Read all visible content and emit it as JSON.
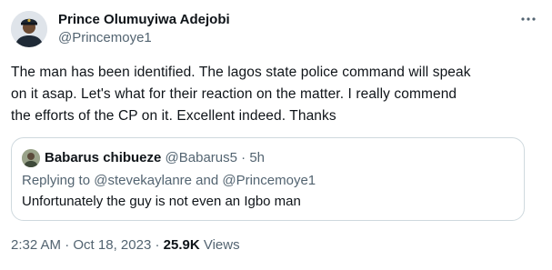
{
  "author": {
    "name": "Prince Olumuyiwa Adejobi",
    "handle": "@Princemoye1"
  },
  "tweet": {
    "text": "The man has been identified. The lagos state police command will speak\non it asap. Let's what for their reaction on the matter. I really commend\nthe efforts of the CP on it. Excellent indeed. Thanks"
  },
  "quote": {
    "name": "Babarus chibueze",
    "handle": "@Babarus5",
    "separator": "·",
    "time": "5h",
    "replying_prefix": "Replying to ",
    "replying_to_1": "@stevekaylanre",
    "replying_and": " and ",
    "replying_to_2": "@Princemoye1",
    "text": "Unfortunately the guy is not even an Igbo man"
  },
  "meta": {
    "time": "2:32 AM",
    "separator": " · ",
    "date": "Oct 18, 2023",
    "views_count": "25.9K",
    "views_label": "Views"
  },
  "icons": {
    "more": "more-horizontal-icon"
  }
}
